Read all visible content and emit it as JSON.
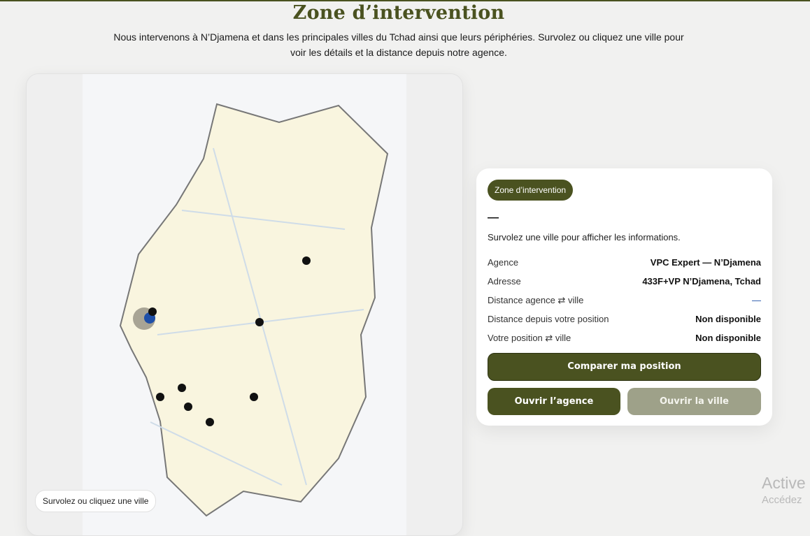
{
  "page": {
    "title": "Zone d’intervention",
    "intro": "Nous intervenons à N’Djamena et dans les principales villes du Tchad ainsi que leurs périphéries. Survolez ou cliquez une ville pour voir les détails et la distance depuis notre agence."
  },
  "map": {
    "hint": "Survolez ou cliquez une ville",
    "colors": {
      "land": "#f9f5df",
      "border": "#777777",
      "roads": "#cfdce8",
      "city": "#111111",
      "agency": "#1e4fa8",
      "agency_halo": "#a8a495"
    }
  },
  "info": {
    "badge": "Zone d’intervention",
    "city_name": "—",
    "hover_hint": "Survolez une ville pour afficher les informations.",
    "rows": [
      {
        "label": "Agence",
        "value": "VPC Expert — N’Djamena"
      },
      {
        "label": "Adresse",
        "value": "433F+VP N’Djamena, Tchad"
      },
      {
        "label": "Distance agence ⇄ ville",
        "value": "—"
      },
      {
        "label": "Distance depuis votre position",
        "value": "Non disponible"
      },
      {
        "label": "Votre position ⇄ ville",
        "value": "Non disponible"
      }
    ],
    "buttons": {
      "compare": "Comparer ma position",
      "open_agency": "Ouvrir l’agence",
      "open_city": "Ouvrir la ville"
    }
  },
  "watermark": {
    "line1": "Active",
    "line2": "Accédez"
  },
  "colors": {
    "accent": "#4a5220",
    "accent_muted": "#9ea189"
  }
}
